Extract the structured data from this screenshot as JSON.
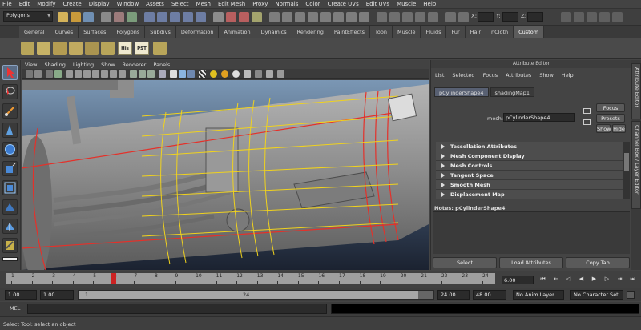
{
  "menubar": [
    "File",
    "Edit",
    "Modify",
    "Create",
    "Display",
    "Window",
    "Assets",
    "Select",
    "Mesh",
    "Edit Mesh",
    "Proxy",
    "Normals",
    "Color",
    "Create UVs",
    "Edit UVs",
    "Muscle",
    "Help"
  ],
  "status_line": {
    "mode": "Polygons",
    "coord_labels": [
      "X:",
      "Y:",
      "Z:"
    ]
  },
  "shelf": {
    "tabs": [
      "General",
      "Curves",
      "Surfaces",
      "Polygons",
      "Subdivs",
      "Deformation",
      "Animation",
      "Dynamics",
      "Rendering",
      "PaintEffects",
      "Toon",
      "Muscle",
      "Fluids",
      "Fur",
      "Hair",
      "nCloth",
      "Custom"
    ],
    "active_tab": "Custom",
    "text_icons": [
      "His",
      "PST"
    ]
  },
  "viewport": {
    "menu": [
      "View",
      "Shading",
      "Lighting",
      "Show",
      "Renderer",
      "Panels"
    ]
  },
  "attribute_editor": {
    "title": "Attribute Editor",
    "menu": [
      "List",
      "Selected",
      "Focus",
      "Attributes",
      "Show",
      "Help"
    ],
    "tabs": [
      "pCylinderShape4",
      "shadingMap1"
    ],
    "active_tab": "pCylinderShape4",
    "buttons": {
      "focus": "Focus",
      "presets": "Presets",
      "show": "Show",
      "hide": "Hide"
    },
    "mesh_label": "mesh:",
    "mesh_value": "pCylinderShape4",
    "sections": [
      "Tessellation Attributes",
      "Mesh Component Display",
      "Mesh Controls",
      "Tangent Space",
      "Smooth Mesh",
      "Displacement Map"
    ],
    "notes": "Notes:  pCylinderShape4",
    "bottom_buttons": [
      "Select",
      "Load Attributes",
      "Copy Tab"
    ]
  },
  "side_tabs": [
    "Attribute Editor",
    "Channel Box / Layer Editor"
  ],
  "time_slider": {
    "ticks": [
      "1",
      "2",
      "3",
      "4",
      "5",
      "6",
      "7",
      "8",
      "9",
      "10",
      "11",
      "12",
      "13",
      "14",
      "15",
      "16",
      "17",
      "18",
      "19",
      "20",
      "21",
      "22",
      "23",
      "24"
    ],
    "current_frame": "6.00",
    "current_fraction": 0.215
  },
  "range_slider": {
    "start": "1.00",
    "playback_start": "1.00",
    "bar_start": "1",
    "bar_end": "24",
    "playback_end": "24.00",
    "end": "48.00",
    "anim_layer": "No Anim Layer",
    "character_set": "No Character Set"
  },
  "command_line": {
    "label": "MEL"
  },
  "help_line": "Select Tool: select an object",
  "colors": {
    "panel": "#444444",
    "active_tab": "#586072",
    "ruler": "#9f9f9f",
    "edge_red": "#e4312a",
    "edge_yellow": "#f0d21e"
  }
}
